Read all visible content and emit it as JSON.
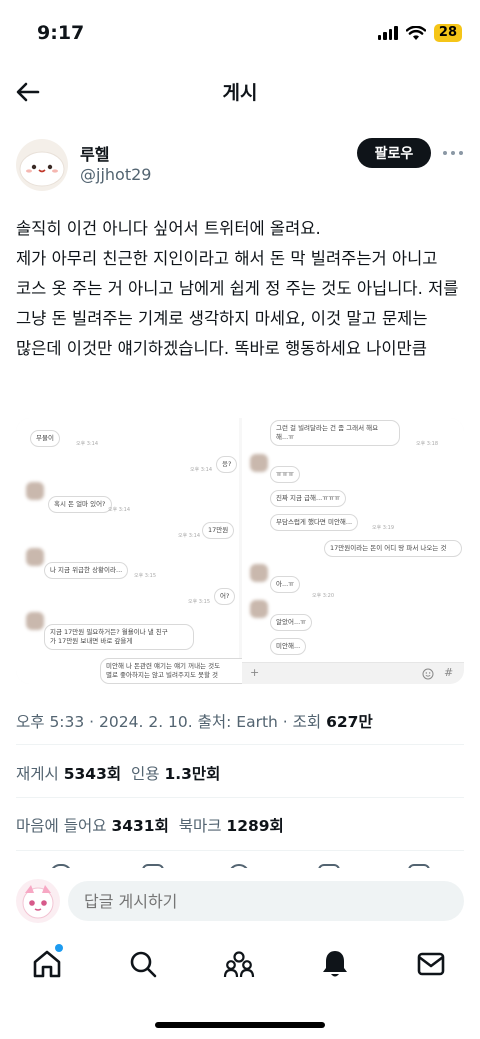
{
  "status": {
    "time": "9:17",
    "battery": "28"
  },
  "header": {
    "title": "게시"
  },
  "author": {
    "name": "루헬",
    "handle": "@jjhot29",
    "follow_label": "팔로우"
  },
  "tweet": {
    "text": "솔직히 이건 아니다 싶어서 트위터에 올려요.\n제가 아무리 친근한 지인이라고 해서 돈 막 빌려주는거 아니고 코스 옷 주는 거 아니고 남에게 쉽게 정 주는 것도 아닙니다. 저를 그냥 돈 빌려주는 기계로 생각하지 마세요, 이것 말고 문제는 많은데 이것만 얘기하겠습니다. 똑바로 행동하세요 나이만큼"
  },
  "media": {
    "left_messages": [
      "무물이",
      "응?",
      "혹시 돈 얼마 있어?",
      "17만원",
      "나 지금 위급한 상황이라...",
      "어?",
      "지금 17만원 필요하거든? 월욜이나 낼 친구",
      "가 17만원 보내면 바로 갚을게",
      "미안해 나 돈관련 얘기는 얘기 꺼내는 것도",
      "별로 좋아하지는 않고 빌려주지도 못할 것"
    ],
    "left_times": [
      "오후 3:14",
      "오후 3:14",
      "오후 3:14",
      "오후 3:14",
      "오후 3:15",
      "오후 3:15"
    ],
    "right_messages": [
      "그런 걸 빌려달라는 건 좀 그래서 해요",
      "해...ㅠ",
      "ㅠㅠㅠ",
      "진짜 지금 급해...ㅠㅠㅠ",
      "부담스럽게 했다면 미안해...",
      "17만원이라는 돈이 어디 땅 파서 나오는 것",
      "아...ㅠ",
      "알았어...ㅠ",
      "미안해..."
    ],
    "right_times": [
      "오후 3:18",
      "오후 3:19",
      "오후 3:20"
    ],
    "input_plus": "+",
    "input_hash": "#"
  },
  "meta": {
    "prefix": "오후 5:33 · 2024. 2. 10. 출처: Earth · 조회 ",
    "views": "627만"
  },
  "stats": {
    "retweets_label": "재게시",
    "retweets": "5343회",
    "quotes_label": "인용",
    "quotes": "1.3만회",
    "likes_label": "마음에 들어요",
    "likes": "3431회",
    "bookmarks_label": "북마크",
    "bookmarks": "1289회"
  },
  "reply": {
    "placeholder": "답글 게시하기"
  },
  "colors": {
    "accent": "#1d9bf0",
    "text": "#0f1419",
    "secondary": "#536471",
    "battery": "#f5c518"
  },
  "icons": [
    "back-arrow-icon",
    "more-icon",
    "home-icon",
    "search-icon",
    "communities-icon",
    "notifications-icon",
    "messages-icon"
  ]
}
